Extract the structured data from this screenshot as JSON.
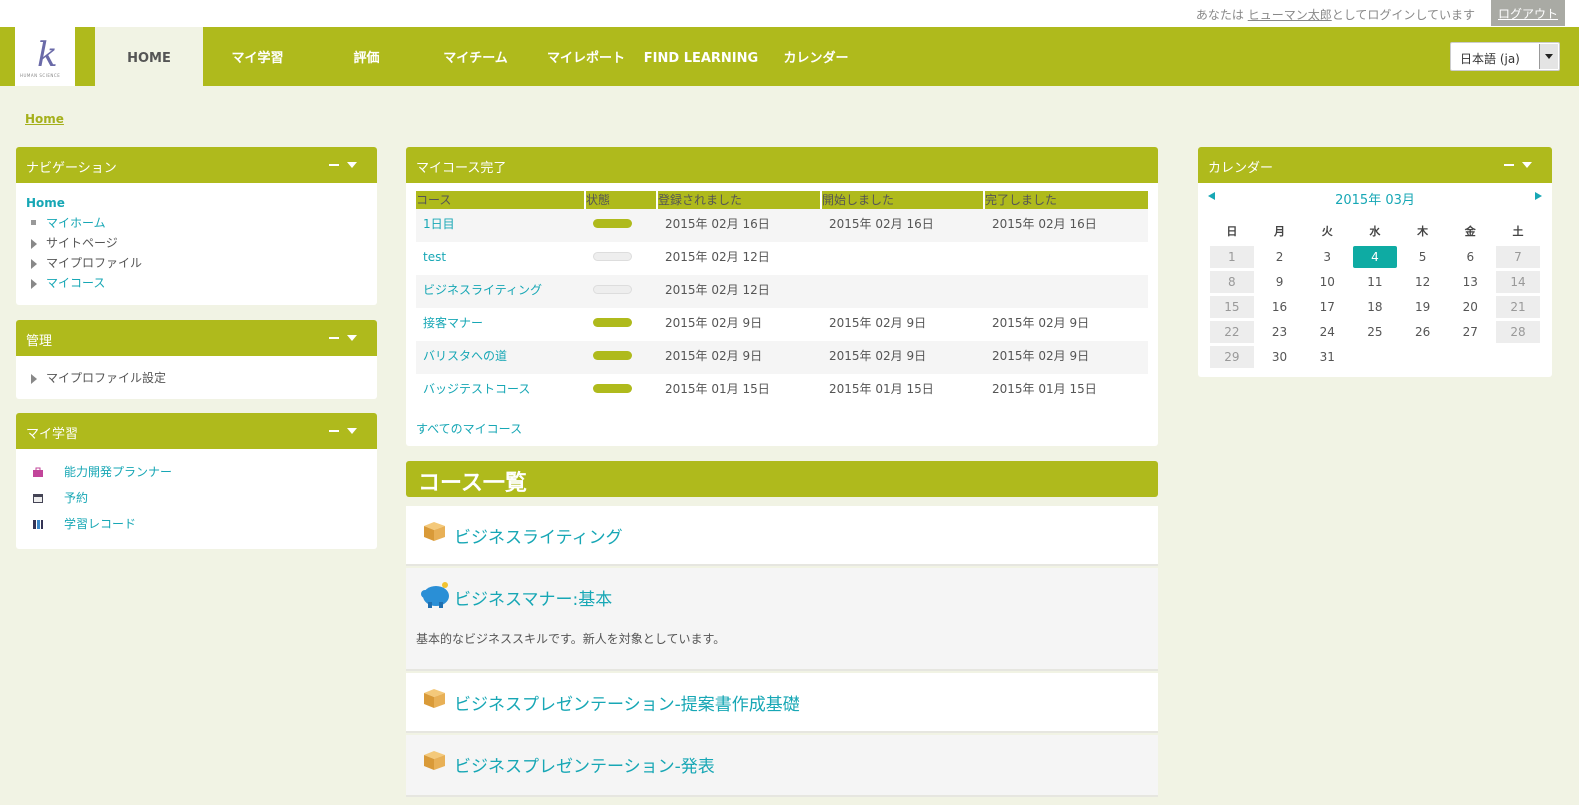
{
  "topbar": {
    "login_prefix": "あなたは",
    "user_name": "ヒューマン太郎",
    "login_suffix": "としてログインしています",
    "logout_label": "ログアウト"
  },
  "header": {
    "logo_text": "HUMAN SCIENCE",
    "nav": [
      "HOME",
      "マイ学習",
      "評価",
      "マイチーム",
      "マイレポート",
      "FIND LEARNING",
      "カレンダー"
    ],
    "language": "日本語 (ja)"
  },
  "breadcrumb": "Home",
  "navigation_block": {
    "title": "ナビゲーション",
    "home": "Home",
    "items": [
      "マイホーム",
      "サイトページ",
      "マイプロファイル",
      "マイコース"
    ]
  },
  "admin_block": {
    "title": "管理",
    "items": [
      "マイプロファイル設定"
    ]
  },
  "mylearning_block": {
    "title": "マイ学習",
    "items": [
      {
        "label": "能力開発プランナー",
        "icon": "briefcase-icon"
      },
      {
        "label": "予約",
        "icon": "calendar-book-icon"
      },
      {
        "label": "学習レコード",
        "icon": "records-icon"
      }
    ]
  },
  "completion_block": {
    "title": "マイコース完了",
    "columns": [
      "コース",
      "状態",
      "登録されました",
      "開始しました",
      "完了しました"
    ],
    "rows": [
      {
        "course": "1日目",
        "status": "complete",
        "enrolled": "2015年 02月 16日",
        "started": "2015年 02月 16日",
        "completed": "2015年 02月 16日"
      },
      {
        "course": "test",
        "status": "not-started",
        "enrolled": "2015年 02月 12日",
        "started": "",
        "completed": ""
      },
      {
        "course": "ビジネスライティング",
        "status": "not-started",
        "enrolled": "2015年 02月 12日",
        "started": "",
        "completed": ""
      },
      {
        "course": "接客マナー",
        "status": "complete",
        "enrolled": "2015年 02月 9日",
        "started": "2015年 02月 9日",
        "completed": "2015年 02月 9日"
      },
      {
        "course": "バリスタへの道",
        "status": "complete",
        "enrolled": "2015年 02月 9日",
        "started": "2015年 02月 9日",
        "completed": "2015年 02月 9日"
      },
      {
        "course": "バッジテストコース",
        "status": "complete",
        "enrolled": "2015年 01月 15日",
        "started": "2015年 01月 15日",
        "completed": "2015年 01月 15日"
      }
    ],
    "all_courses_link": "すべてのマイコース"
  },
  "course_list": {
    "title": "コース一覧",
    "courses": [
      {
        "name": "ビジネスライティング",
        "icon": "box-icon",
        "description": ""
      },
      {
        "name": "ビジネスマナー:基本",
        "icon": "piggy-bank-icon",
        "description": "基本的なビジネススキルです。新人を対象としています。"
      },
      {
        "name": "ビジネスプレゼンテーション-提案書作成基礎",
        "icon": "box-icon",
        "description": ""
      },
      {
        "name": "ビジネスプレゼンテーション-発表",
        "icon": "box-icon",
        "description": ""
      }
    ]
  },
  "calendar_block": {
    "title": "カレンダー",
    "month": "2015年 03月",
    "weekdays": [
      "日",
      "月",
      "火",
      "水",
      "木",
      "金",
      "土"
    ],
    "weeks": [
      [
        "1",
        "2",
        "3",
        "4",
        "5",
        "6",
        "7"
      ],
      [
        "8",
        "9",
        "10",
        "11",
        "12",
        "13",
        "14"
      ],
      [
        "15",
        "16",
        "17",
        "18",
        "19",
        "20",
        "21"
      ],
      [
        "22",
        "23",
        "24",
        "25",
        "26",
        "27",
        "28"
      ],
      [
        "29",
        "30",
        "31",
        "",
        "",
        "",
        ""
      ]
    ],
    "today": "4"
  },
  "colors": {
    "brand": "#afba1c",
    "link": "#17a7b5",
    "today": "#0eaba3",
    "background": "#f1f3e4"
  }
}
